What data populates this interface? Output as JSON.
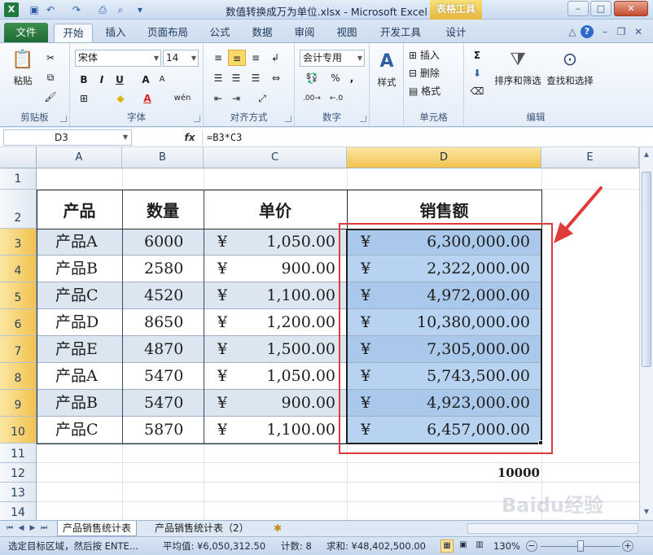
{
  "window": {
    "title": "数值转换成万为单位.xlsx - Microsoft Excel",
    "context_tab": "表格工具",
    "app_logo": "X"
  },
  "quick_access": [
    "save-icon",
    "undo-icon",
    "redo-icon",
    "print-icon",
    "print-preview-icon",
    "customize-icon"
  ],
  "ribbon_tabs": [
    "文件",
    "开始",
    "插入",
    "页面布局",
    "公式",
    "数据",
    "审阅",
    "视图",
    "开发工具",
    "设计"
  ],
  "active_tab": "开始",
  "ribbon": {
    "clipboard": {
      "paste": "粘贴",
      "group": "剪贴板"
    },
    "font": {
      "name": "宋体",
      "size": "14",
      "group": "字体",
      "bold": "B",
      "italic": "I",
      "underline": "U",
      "grow": "A",
      "shrink": "A",
      "wen": "wén"
    },
    "alignment": {
      "group": "对齐方式"
    },
    "number": {
      "format": "会计专用",
      "group": "数字",
      "percent": "%",
      "comma": ","
    },
    "styles": {
      "label": "样式"
    },
    "cells": {
      "insert": "插入",
      "delete": "删除",
      "format": "格式",
      "group": "单元格"
    },
    "editing": {
      "sum": "Σ",
      "sort_filter": "排序和筛选",
      "find_select": "查找和选择",
      "group": "编辑"
    }
  },
  "formula_bar": {
    "name_box": "D3",
    "fx": "fx",
    "formula": "=B3*C3"
  },
  "columns": [
    "A",
    "B",
    "C",
    "D",
    "E"
  ],
  "rows": [
    "1",
    "2",
    "3",
    "4",
    "5",
    "6",
    "7",
    "8",
    "9",
    "10",
    "11",
    "12",
    "13",
    "14"
  ],
  "table": {
    "headers": [
      "产品",
      "数量",
      "单价",
      "销售额"
    ],
    "currency": "¥",
    "rows": [
      {
        "product": "产品A",
        "qty": "6000",
        "price": "1,050.00",
        "sales": "6,300,000.00"
      },
      {
        "product": "产品B",
        "qty": "2580",
        "price": "900.00",
        "sales": "2,322,000.00"
      },
      {
        "product": "产品C",
        "qty": "4520",
        "price": "1,100.00",
        "sales": "4,972,000.00"
      },
      {
        "product": "产品D",
        "qty": "8650",
        "price": "1,200.00",
        "sales": "10,380,000.00"
      },
      {
        "product": "产品E",
        "qty": "4870",
        "price": "1,500.00",
        "sales": "7,305,000.00"
      },
      {
        "product": "产品A",
        "qty": "5470",
        "price": "1,050.00",
        "sales": "5,743,500.00"
      },
      {
        "product": "产品B",
        "qty": "5470",
        "price": "900.00",
        "sales": "4,923,000.00"
      },
      {
        "product": "产品C",
        "qty": "5870",
        "price": "1,100.00",
        "sales": "6,457,000.00"
      }
    ],
    "extra_value": "10000"
  },
  "sheet_tabs": [
    "产品销售统计表",
    "产品销售统计表（2）"
  ],
  "active_sheet": "产品销售统计表",
  "status": {
    "hint": "选定目标区域，然后按 ENTE...",
    "average": "平均值: ¥6,050,312.50",
    "count": "计数: 8",
    "sum": "求和: ¥48,402,500.00",
    "zoom": "130%"
  },
  "watermark": "Baidu经验",
  "colors": {
    "selection": "#b7d3f1",
    "band": "#dce6f1",
    "annotation": "#e03a3a",
    "accent": "#1f6b34"
  }
}
